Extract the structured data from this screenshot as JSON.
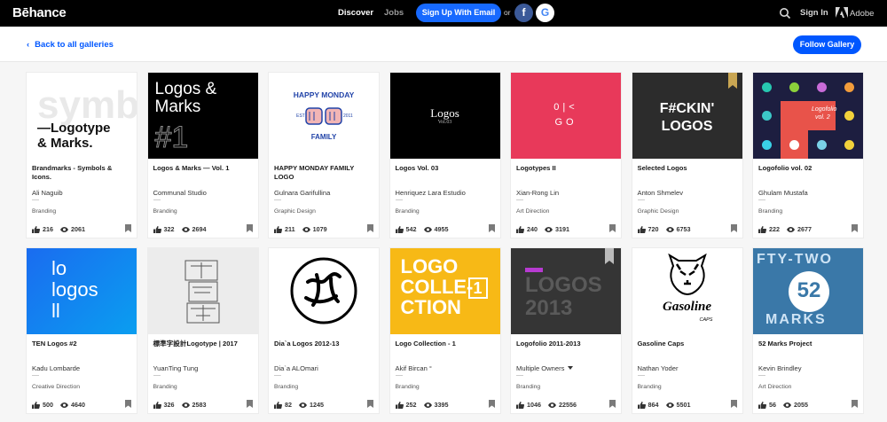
{
  "nav": {
    "logo": "Bēhance",
    "discover": "Discover",
    "jobs": "Jobs",
    "signup": "Sign Up With Email",
    "or": "or",
    "facebook": "f",
    "google": "G",
    "signin": "Sign In",
    "adobe": "Adobe"
  },
  "subheader": {
    "back": "Back to all galleries",
    "follow": "Follow Gallery"
  },
  "cards": [
    {
      "title": "Brandmarks - Symbols & Icons.",
      "owner": "Ali Naguib",
      "category": "Branding",
      "likes": "216",
      "views": "2061"
    },
    {
      "title": "Logos & Marks — Vol. 1",
      "owner": "Communal Studio",
      "category": "Branding",
      "likes": "322",
      "views": "2694"
    },
    {
      "title": "HAPPY MONDAY FAMILY LOGO",
      "owner": "Gulnara Garifullina",
      "category": "Graphic Design",
      "likes": "211",
      "views": "1079"
    },
    {
      "title": "Logos Vol. 03",
      "owner": "Henriquez Lara Estudio",
      "category": "Branding",
      "likes": "542",
      "views": "4955"
    },
    {
      "title": "Logotypes II",
      "owner": "Xian-Rong Lin",
      "category": "Art Direction",
      "likes": "240",
      "views": "3191"
    },
    {
      "title": "Selected Logos",
      "owner": "Anton Shmelev",
      "category": "Graphic Design",
      "likes": "720",
      "views": "6753"
    },
    {
      "title": "Logofolio vol. 02",
      "owner": "Ghulam Mustafa",
      "category": "Branding",
      "likes": "222",
      "views": "2677"
    },
    {
      "title": "TEN Logos #2",
      "owner": "Kadu Lombarde",
      "category": "Creative Direction",
      "likes": "500",
      "views": "4640"
    },
    {
      "title": "標準字設計Logotype | 2017",
      "owner": "YuanTing Tung",
      "category": "Branding",
      "likes": "326",
      "views": "2583"
    },
    {
      "title": "Dia`a Logos 2012-13",
      "owner": "Dia`a ALOmari",
      "category": "Branding",
      "likes": "82",
      "views": "1245"
    },
    {
      "title": "Logo Collection - 1",
      "owner": "Akif Bircan °",
      "category": "Branding",
      "likes": "252",
      "views": "3395"
    },
    {
      "title": "Logofolio 2011-2013",
      "owner": "Multiple Owners",
      "category": "Branding",
      "likes": "1046",
      "views": "22556"
    },
    {
      "title": "Gasoline Caps",
      "owner": "Nathan Yoder",
      "category": "Branding",
      "likes": "864",
      "views": "5501"
    },
    {
      "title": "52 Marks Project",
      "owner": "Kevin Brindley",
      "category": "Art Direction",
      "likes": "56",
      "views": "2055"
    }
  ],
  "thumbs": {
    "t0": {
      "line1": "symb",
      "line2": "—Logotype",
      "line3": "& Marks."
    },
    "t1": {
      "line1": "Logos &",
      "line2": "Marks",
      "line3": "#1"
    },
    "t2": {
      "line1": "HAPPY MONDAY",
      "line2": "FAMILY",
      "small1": "EST",
      "small2": "2011"
    },
    "t3": {
      "line1": "Logos",
      "line2": "Vol.03"
    },
    "t4": {
      "line1": "0|<",
      "line2": "GO"
    },
    "t5": {
      "line1": "F#CKIN'",
      "line2": "LOGOS"
    },
    "t6": {
      "line1": "Logofolio",
      "line2": "vol. 2"
    },
    "t7": {
      "line1": "lo",
      "line2": "logos",
      "line3": "ll"
    },
    "t10": {
      "line1": "LOGO",
      "line2": "COLLE-",
      "line3": "CTION",
      "box": "1"
    },
    "t11": {
      "line1": "LOGOS",
      "line2": "2013"
    },
    "t12": {
      "line1": "Gasoline",
      "line2": "CAPS"
    },
    "t13": {
      "line1": "52",
      "line2": "MARKS",
      "line3": "FTY-TWO"
    }
  },
  "colors": {
    "accent": "#1769ff",
    "follow": "#0057ff",
    "navbg": "#000000"
  }
}
